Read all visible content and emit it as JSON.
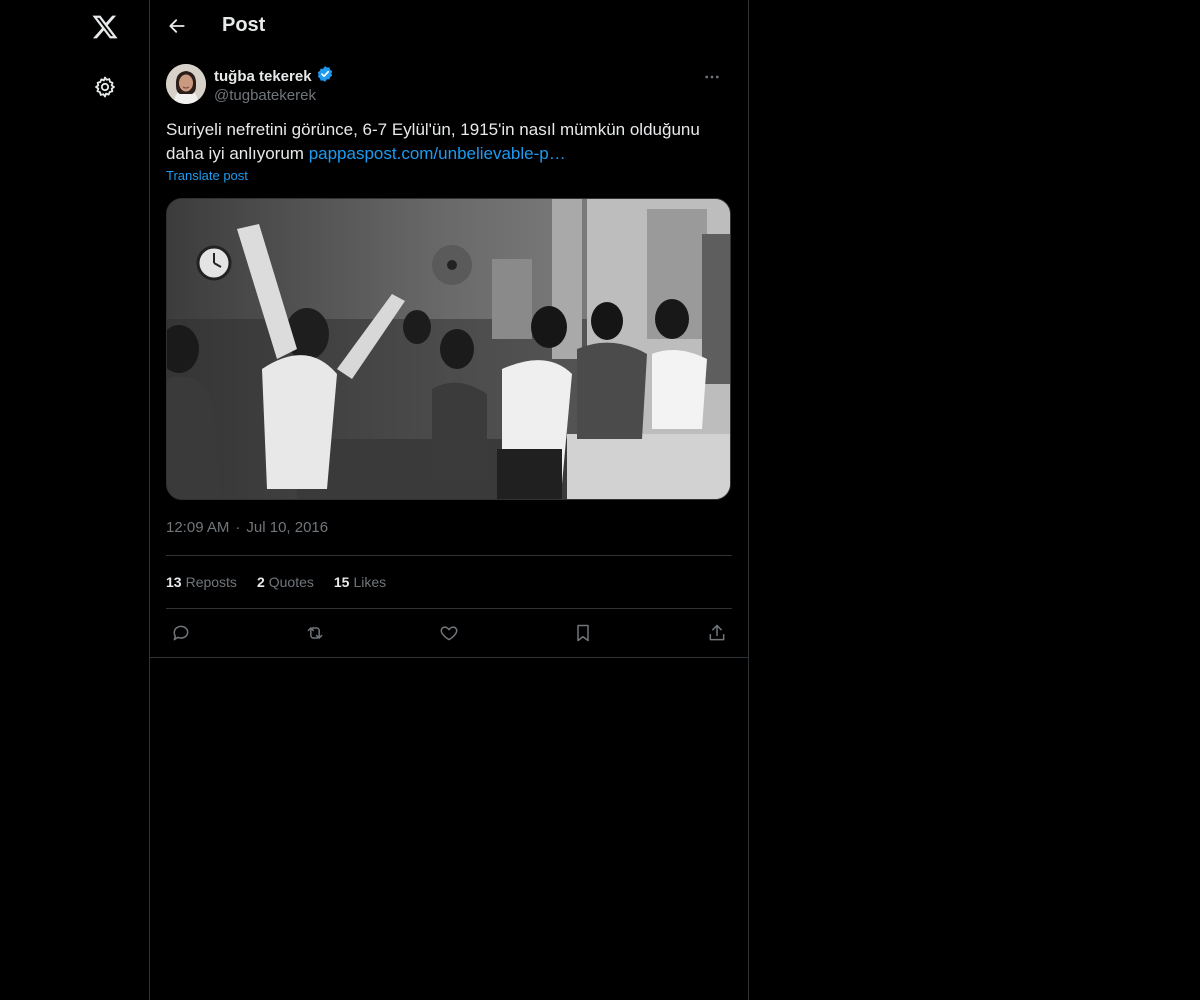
{
  "nav": {
    "logo_icon": "x-logo-icon",
    "settings_icon": "gear-icon"
  },
  "header": {
    "title": "Post"
  },
  "post": {
    "author": {
      "name": "tuğba tekerek",
      "handle": "@tugbatekerek",
      "verified": true
    },
    "text": "Suriyeli nefretini görünce, 6-7 Eylül'ün, 1915'in nasıl mümkün olduğunu daha iyi anlıyorum ",
    "link_text": "pappaspost.com/unbelievable-p…",
    "translate_label": "Translate post",
    "time": "12:09 AM",
    "date": "Jul 10, 2016",
    "separator": "·",
    "stats": {
      "reposts_count": "13",
      "reposts_label": "Reposts",
      "quotes_count": "2",
      "quotes_label": "Quotes",
      "likes_count": "15",
      "likes_label": "Likes"
    }
  },
  "colors": {
    "background": "#000000",
    "text": "#e7e9ea",
    "muted": "#71767b",
    "accent": "#1d9bf0",
    "border": "#2f3336"
  }
}
